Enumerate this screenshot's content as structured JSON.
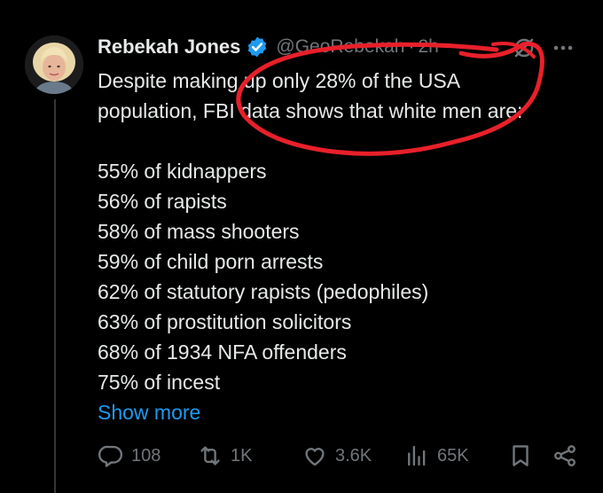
{
  "author": {
    "name": "Rebekah Jones",
    "handle": "@GeoRebekah",
    "separator": "·",
    "time": "2h"
  },
  "tweet": {
    "intro_line1": "Despite making up only 28% of the USA",
    "intro_line2": "population, FBI data shows that white men are:",
    "stats": [
      "55% of kidnappers",
      "56% of rapists",
      "58% of mass shooters",
      "59% of child porn arrests",
      "62% of statutory rapists (pedophiles)",
      "63% of prostitution solicitors",
      "68% of 1934 NFA offenders",
      "75% of incest"
    ],
    "show_more": "Show more"
  },
  "actions": {
    "replies": "108",
    "reposts": "1K",
    "likes": "3.6K",
    "views": "65K"
  },
  "colors": {
    "background": "#000000",
    "text": "#e7e9ea",
    "muted": "#71767b",
    "link": "#1d9bf0",
    "verified": "#1d9bf0",
    "annotation": "#e8202a"
  },
  "icons": {
    "verified": "verified-badge-icon",
    "grok": "grok-icon",
    "more": "more-options-icon",
    "reply": "reply-icon",
    "repost": "repost-icon",
    "like": "like-icon",
    "views": "views-icon",
    "bookmark": "bookmark-icon",
    "share": "share-icon"
  }
}
